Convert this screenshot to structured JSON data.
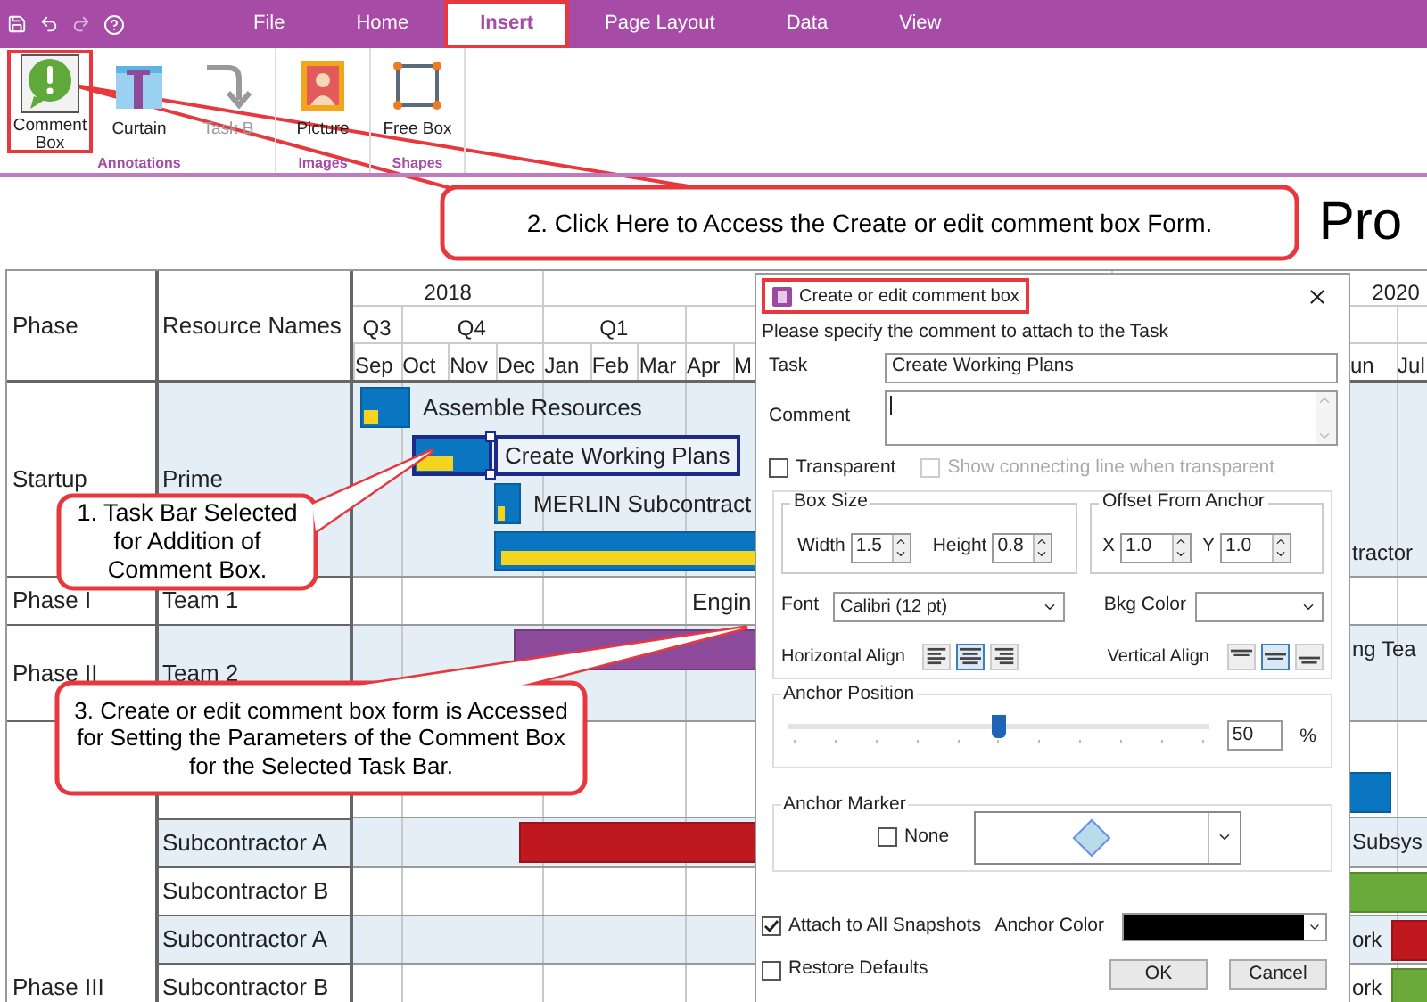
{
  "menu_tabs": [
    {
      "label": "File",
      "selected": false,
      "highlighted": false
    },
    {
      "label": "Home",
      "selected": false,
      "highlighted": false
    },
    {
      "label": "Insert",
      "selected": true,
      "highlighted": true
    },
    {
      "label": "Page Layout",
      "selected": false,
      "highlighted": false
    },
    {
      "label": "Data",
      "selected": false,
      "highlighted": false
    },
    {
      "label": "View",
      "selected": false,
      "highlighted": false
    }
  ],
  "ribbon": {
    "groups": [
      {
        "label": "Annotations",
        "buttons": [
          {
            "label": "Comment Box",
            "kind": "comment",
            "highlighted": true,
            "disabled": false
          },
          {
            "label": "Curtain",
            "kind": "curtain",
            "highlighted": false,
            "disabled": false
          },
          {
            "label": "Task B",
            "kind": "task",
            "highlighted": false,
            "disabled": true
          }
        ]
      },
      {
        "label": "Images",
        "buttons": [
          {
            "label": "Picture",
            "kind": "picture",
            "highlighted": false,
            "disabled": false
          }
        ]
      },
      {
        "label": "Shapes",
        "buttons": [
          {
            "label": "Free Box",
            "kind": "freebox",
            "highlighted": false,
            "disabled": false
          }
        ]
      }
    ]
  },
  "title": "Pro",
  "gantt": {
    "phase_heading": "Phase",
    "resource_heading": "Resource Names",
    "years": [
      "2018",
      "2020"
    ],
    "quarters": [
      "Q3",
      "Q4",
      "Q1"
    ],
    "months": [
      "Sep",
      "Oct",
      "Nov",
      "Dec",
      "Jan",
      "Feb",
      "Mar",
      "Apr",
      "M",
      "un",
      "Jul"
    ],
    "phases": [
      {
        "name": "Startup",
        "rows": [
          {
            "resource": "Prime",
            "shaded": true,
            "bars": [
              {
                "kind": "task",
                "level": 0.35,
                "color": "#0a76c2",
                "selected": false,
                "label": "Assemble Resources"
              },
              {
                "kind": "task",
                "level": 0.5,
                "color": "#0a76c2",
                "selected": true,
                "label": "Create Working Plans"
              },
              {
                "kind": "task",
                "level": 0.4,
                "color": "#0a76c2",
                "selected": false,
                "label": "MERLIN Subcontract"
              },
              {
                "kind": "summary",
                "level": 1,
                "color": "#0a76c2",
                "selected": false
              }
            ],
            "labels": [
              "tractor"
            ]
          }
        ]
      },
      {
        "name": "Phase I",
        "rows": [
          {
            "resource": "Team 1",
            "shaded": false,
            "bars": [],
            "labels": [
              "Engin"
            ]
          }
        ]
      },
      {
        "name": "Phase II",
        "rows": [
          {
            "resource": "Team 2",
            "shaded": true,
            "bars": [
              {
                "kind": "solid",
                "color": "#8e4a9a",
                "selected": false
              }
            ],
            "labels": [
              "ng Tea"
            ]
          }
        ]
      },
      {
        "name": "Phase III",
        "rows": [
          {
            "resource": "",
            "shaded": false,
            "bars": [
              {
                "kind": "solid",
                "color": "#0a76c2",
                "selected": false
              }
            ],
            "labels": []
          },
          {
            "resource": "Subcontractor A",
            "shaded": true,
            "bars": [
              {
                "kind": "solid",
                "color": "#c0181f",
                "selected": false
              }
            ],
            "labels": [
              "Subsys"
            ]
          },
          {
            "resource": "Subcontractor B",
            "shaded": false,
            "bars": [
              {
                "kind": "solid",
                "color": "#6aaa3a",
                "selected": false
              }
            ],
            "labels": []
          },
          {
            "resource": "Subcontractor A",
            "shaded": true,
            "bars": [
              {
                "kind": "solid",
                "color": "#c0181f",
                "selected": false
              }
            ],
            "labels": [
              "ork"
            ]
          },
          {
            "resource": "Subcontractor B",
            "shaded": false,
            "bars": [
              {
                "kind": "solid",
                "color": "#6aaa3a",
                "selected": false
              }
            ],
            "labels": [
              "ork"
            ]
          }
        ]
      }
    ]
  },
  "dialog": {
    "title": "Create or edit comment box",
    "highlighted": true,
    "prompt": "Please specify the comment to attach to the Task",
    "task": {
      "label": "Task",
      "value": "Create Working Plans"
    },
    "comment": {
      "label": "Comment"
    },
    "transparent": {
      "label": "Transparent",
      "checked": false,
      "disabled": false
    },
    "show_line": {
      "label": "Show connecting line when transparent",
      "checked": false,
      "disabled": true
    },
    "box_size": {
      "title": "Box Size",
      "width": {
        "label": "Width",
        "value": "1.5"
      },
      "height": {
        "label": "Height",
        "value": "0.8"
      }
    },
    "offset": {
      "title": "Offset From Anchor",
      "x": {
        "label": "X",
        "value": "1.0"
      },
      "y": {
        "label": "Y",
        "value": "1.0"
      }
    },
    "font": {
      "label": "Font",
      "value": "Calibri (12 pt)"
    },
    "bkg_color": {
      "label": "Bkg Color"
    },
    "horizontal_align": {
      "label": "Horizontal Align",
      "options": [
        {
          "kind": "left",
          "selected": false
        },
        {
          "kind": "center",
          "selected": true
        },
        {
          "kind": "right",
          "selected": false
        }
      ]
    },
    "vertical_align": {
      "label": "Vertical Align",
      "options": [
        {
          "kind": "top",
          "selected": false
        },
        {
          "kind": "middle",
          "selected": true
        },
        {
          "kind": "bottom",
          "selected": false
        }
      ]
    },
    "anchor_position": {
      "title": "Anchor Position",
      "level": 0.5,
      "value": "50",
      "unit": "%"
    },
    "anchor_marker": {
      "title": "Anchor Marker",
      "none": {
        "label": "None",
        "checked": false,
        "disabled": false
      }
    },
    "attach_all": {
      "label": "Attach to All Snapshots",
      "checked": true,
      "disabled": false
    },
    "anchor_color": {
      "label": "Anchor Color",
      "color": "#000000"
    },
    "restore_defaults": {
      "label": "Restore Defaults",
      "checked": false,
      "disabled": false
    },
    "buttons": [
      "OK",
      "Cancel"
    ]
  },
  "callouts": [
    {
      "text": "2. Click Here to Access the Create or edit comment box Form."
    },
    {
      "text": "1. Task Bar Selected for Addition of Comment Box."
    },
    {
      "text": "3. Create or edit comment box form is Accessed for Setting the Parameters of the Comment Box for the Selected Task Bar."
    }
  ]
}
